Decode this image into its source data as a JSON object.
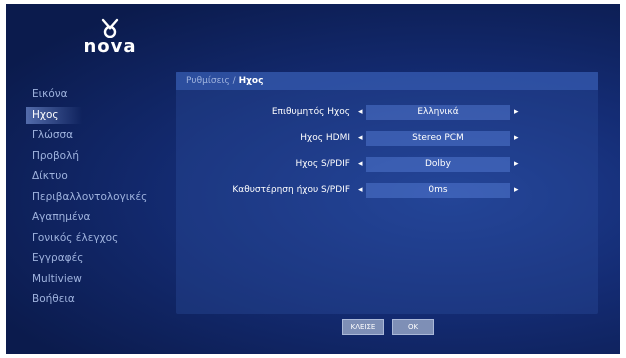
{
  "brand": {
    "logo_text": "nova"
  },
  "sidebar": {
    "items": [
      {
        "label": "Εικόνα"
      },
      {
        "label": "Ηχος"
      },
      {
        "label": "Γλώσσα"
      },
      {
        "label": "Προβολή"
      },
      {
        "label": "Δίκτυο"
      },
      {
        "label": "Περιβαλλοντολογικές"
      },
      {
        "label": "Αγαπημένα"
      },
      {
        "label": "Γονικός έλεγχος"
      },
      {
        "label": "Εγγραφές"
      },
      {
        "label": "Multiview"
      },
      {
        "label": "Βοήθεια"
      }
    ],
    "active_index": 1
  },
  "panel": {
    "breadcrumb_parent": "Ρυθμίσεις / ",
    "breadcrumb_current": "Ηχος",
    "rows": [
      {
        "label": "Επιθυμητός Ηχος",
        "value": "Ελληνικά"
      },
      {
        "label": "Ηχος HDMI",
        "value": "Stereo PCM"
      },
      {
        "label": "Ηχος S/PDIF",
        "value": "Dolby"
      },
      {
        "label": "Καθυστέρηση ήχου S/PDIF",
        "value": "0ms"
      }
    ],
    "arrow_left": "◂",
    "arrow_right": "▸"
  },
  "buttons": {
    "cancel": "ΚΛΕΙΣΕ",
    "ok": "OK"
  }
}
